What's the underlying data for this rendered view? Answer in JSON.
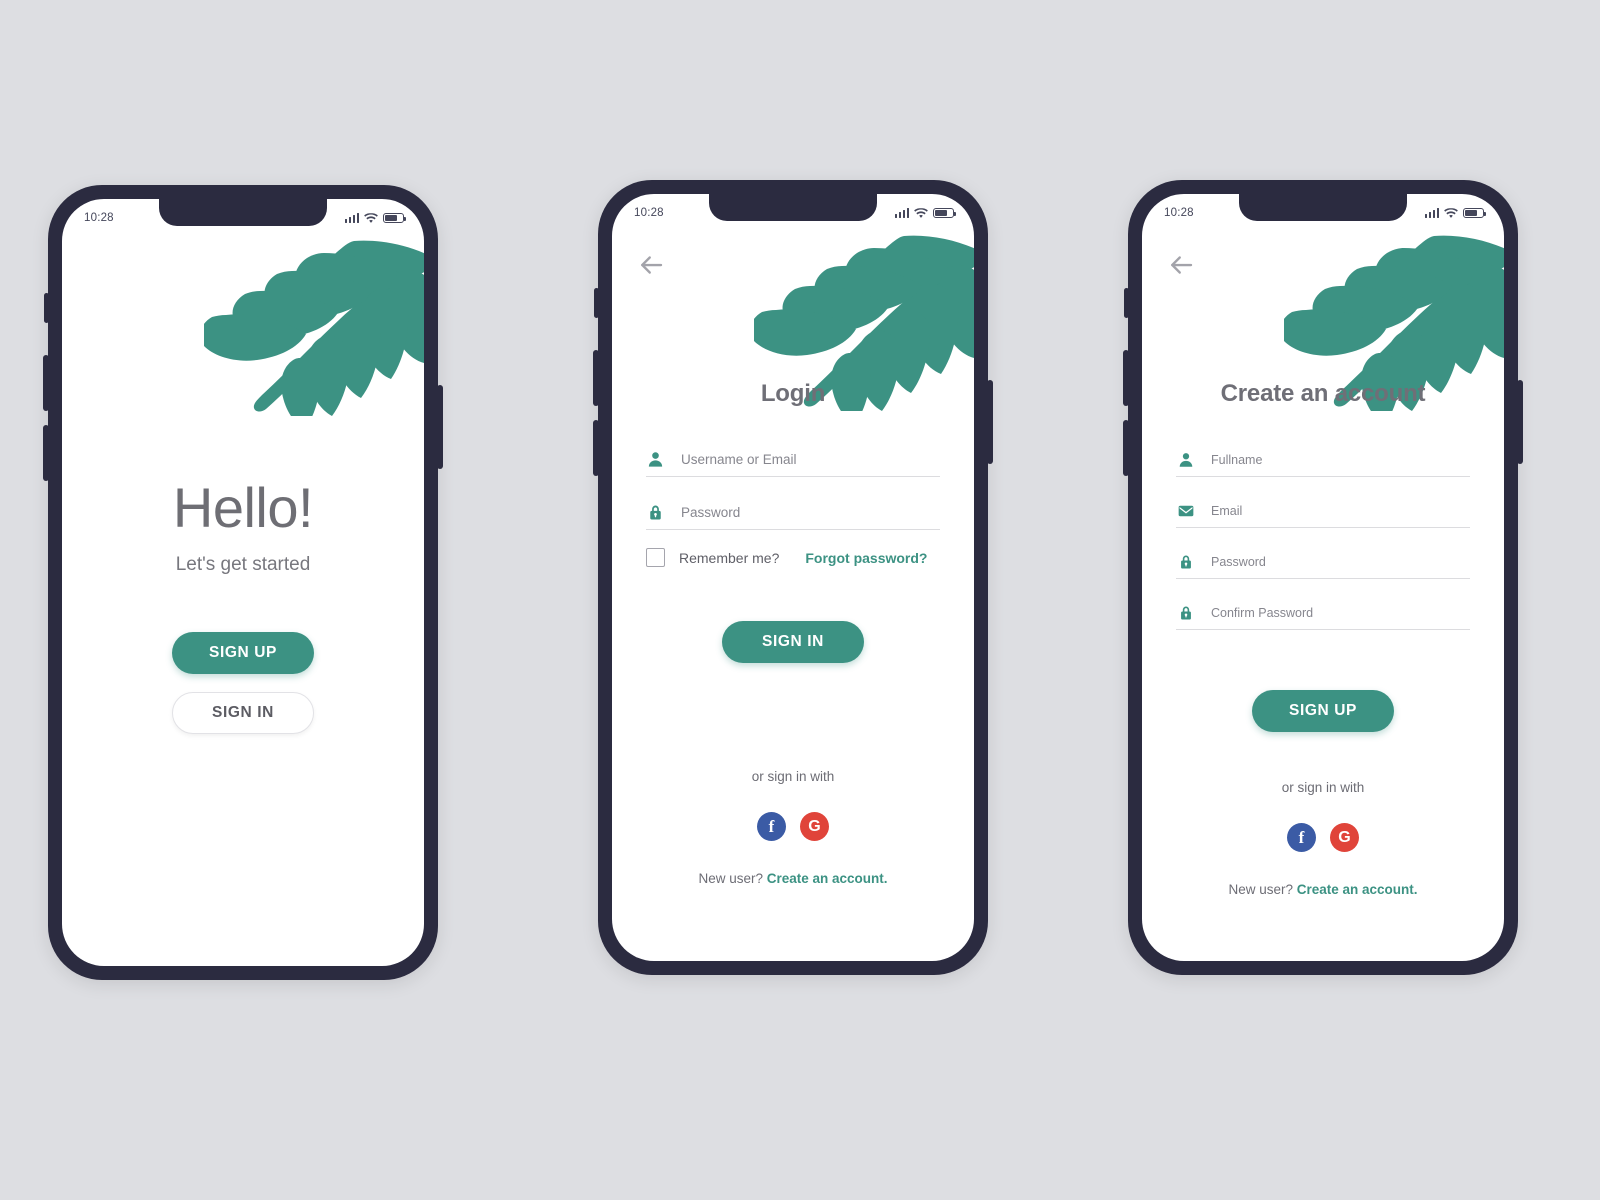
{
  "theme": {
    "accent_green": "#3c9283",
    "frame_dark": "#2b2b40",
    "page_background": "#dddee2",
    "facebook_blue": "#3b5ba5",
    "google_red": "#e0443a",
    "text_gray": "#6f6f77"
  },
  "status_bar": {
    "time": "10:28",
    "signal_icon": "signal-bars-icon",
    "wifi_icon": "wifi-icon",
    "battery_icon": "battery-icon"
  },
  "screens": [
    {
      "id": "welcome",
      "leaf_icon": "palm-leaf-icon",
      "heading": "Hello!",
      "subheading": "Let's get started",
      "primary_button": "SIGN UP",
      "secondary_button": "SIGN IN"
    },
    {
      "id": "login",
      "back_icon": "back-arrow-icon",
      "leaf_icon": "palm-leaf-icon",
      "title": "Login",
      "fields": [
        {
          "icon": "person-icon",
          "placeholder": "Username or Email",
          "value": ""
        },
        {
          "icon": "lock-icon",
          "placeholder": "Password",
          "value": ""
        }
      ],
      "remember_label": "Remember me?",
      "remember_checked": false,
      "forgot_link": "Forgot password?",
      "submit_button": "SIGN IN",
      "or_text": "or sign in with",
      "socials": [
        {
          "name": "facebook-icon",
          "glyph": "f",
          "color": "#3b5ba5"
        },
        {
          "name": "google-icon",
          "glyph": "G",
          "color": "#e0443a"
        }
      ],
      "footer_text": "New user? ",
      "footer_link": "Create an account."
    },
    {
      "id": "signup",
      "back_icon": "back-arrow-icon",
      "leaf_icon": "palm-leaf-icon",
      "title": "Create an account",
      "fields": [
        {
          "icon": "person-icon",
          "placeholder": "Fullname",
          "value": ""
        },
        {
          "icon": "envelope-icon",
          "placeholder": "Email",
          "value": ""
        },
        {
          "icon": "lock-icon",
          "placeholder": "Password",
          "value": ""
        },
        {
          "icon": "lock-icon",
          "placeholder": "Confirm Password",
          "value": ""
        }
      ],
      "submit_button": "SIGN UP",
      "or_text": "or sign in with",
      "socials": [
        {
          "name": "facebook-icon",
          "glyph": "f",
          "color": "#3b5ba5"
        },
        {
          "name": "google-icon",
          "glyph": "G",
          "color": "#e0443a"
        }
      ],
      "footer_text": "New user? ",
      "footer_link": "Create an account."
    }
  ]
}
